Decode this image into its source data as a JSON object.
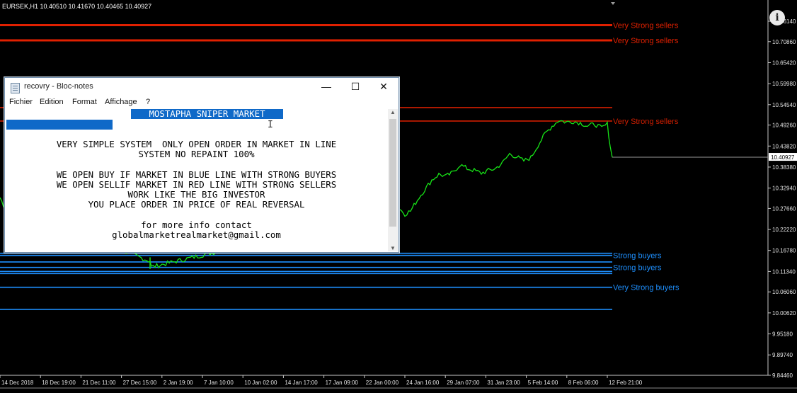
{
  "chart": {
    "symbol_header": "EURSEK,H1  10.40510 10.41670 10.40465 10.40927",
    "current_price_label": "10.40927",
    "price_axis_labels": [
      "10.76140",
      "10.70860",
      "10.65420",
      "10.59980",
      "10.54540",
      "10.49260",
      "10.43820",
      "10.38380",
      "10.32940",
      "10.27660",
      "10.22220",
      "10.16780",
      "10.11340",
      "10.06060",
      "10.00620",
      "9.95180",
      "9.89740",
      "9.84460"
    ],
    "time_axis_labels": [
      "14 Dec 2018",
      "18 Dec 19:00",
      "21 Dec 11:00",
      "27 Dec 15:00",
      "2 Jan 19:00",
      "7 Jan 10:00",
      "10 Jan 02:00",
      "14 Jan 17:00",
      "17 Jan 09:00",
      "22 Jan 00:00",
      "24 Jan 16:00",
      "29 Jan 07:00",
      "31 Jan 23:00",
      "5 Feb 14:00",
      "8 Feb 06:00",
      "12 Feb 21:00"
    ],
    "levels": [
      {
        "price": 10.7514,
        "label": "Very Strong sellers",
        "color": "#e02000"
      },
      {
        "price": 10.712,
        "label": "Very Strong sellers",
        "color": "#e02000"
      },
      {
        "price": 10.5378,
        "label": "",
        "color": "#d01e00"
      },
      {
        "price": 10.503,
        "label": "Very Strong sellers",
        "color": "#d01e00"
      },
      {
        "price": 10.1605,
        "label": "",
        "color": "#1e90ff"
      },
      {
        "price": 10.155,
        "label": "Strong buyers",
        "color": "#1e90ff"
      },
      {
        "price": 10.138,
        "label": "",
        "color": "#1e90ff"
      },
      {
        "price": 10.124,
        "label": "Strong buyers",
        "color": "#1e90ff"
      },
      {
        "price": 10.1135,
        "label": "",
        "color": "#1e90ff"
      },
      {
        "price": 10.108,
        "label": "",
        "color": "#1e90ff"
      },
      {
        "price": 10.0725,
        "label": "Very Strong buyers",
        "color": "#1e90ff"
      },
      {
        "price": 10.0155,
        "label": "",
        "color": "#1e90ff"
      }
    ],
    "price_path": [
      [
        0,
        10.305
      ],
      [
        5,
        10.285
      ],
      [
        212,
        10.14
      ],
      [
        214,
        10.125
      ],
      [
        565,
        10.275
      ],
      [
        572,
        10.262
      ],
      [
        580,
        10.27
      ],
      [
        585,
        10.285
      ],
      [
        592,
        10.305
      ],
      [
        600,
        10.325
      ],
      [
        610,
        10.35
      ],
      [
        620,
        10.365
      ],
      [
        630,
        10.36
      ],
      [
        640,
        10.37
      ],
      [
        650,
        10.39
      ],
      [
        660,
        10.38
      ],
      [
        670,
        10.375
      ],
      [
        680,
        10.368
      ],
      [
        690,
        10.375
      ],
      [
        700,
        10.38
      ],
      [
        710,
        10.395
      ],
      [
        720,
        10.418
      ],
      [
        730,
        10.41
      ],
      [
        740,
        10.4
      ],
      [
        750,
        10.408
      ],
      [
        760,
        10.44
      ],
      [
        770,
        10.47
      ],
      [
        780,
        10.49
      ],
      [
        790,
        10.505
      ],
      [
        800,
        10.5
      ],
      [
        810,
        10.502
      ],
      [
        820,
        10.498
      ],
      [
        830,
        10.49
      ],
      [
        840,
        10.495
      ],
      [
        850,
        10.485
      ],
      [
        858,
        10.495
      ],
      [
        862,
        10.44
      ],
      [
        865,
        10.409
      ]
    ]
  },
  "info_button": {
    "glyph": "i"
  },
  "notepad": {
    "title": "recovry - Bloc-notes",
    "controls": {
      "minimize": "—",
      "maximize": "☐",
      "close": "✕"
    },
    "menu": [
      "Fichier",
      "Edition",
      "Format",
      "Affichage",
      "?"
    ],
    "selected_heading": "MOSTAPHA SNIPER MARKET",
    "lines": [
      "VERY SIMPLE SYSTEM  ONLY OPEN ORDER IN MARKET IN LINE",
      "SYSTEM NO REPAINT 100%",
      "",
      "WE OPEN BUY IF MARKET IN BLUE LINE WITH STRONG BUYERS",
      "WE OPEN SELLIF MARKET IN RED LINE WITH STRONG SELLERS",
      "WORK LIKE THE BIG INVESTOR",
      "YOU PLACE ORDER IN PRICE OF REAL REVERSAL",
      "",
      "for more info contact",
      "globalmarketrealmarket@gmail.com"
    ],
    "caret": "I"
  }
}
